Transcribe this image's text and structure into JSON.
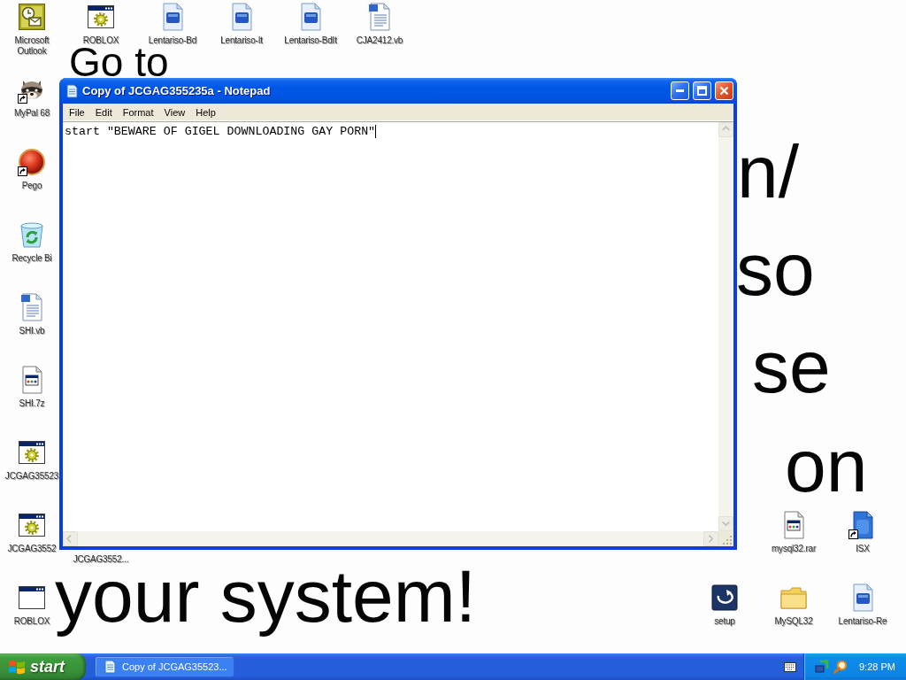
{
  "desktop": {
    "wallpaper_text": [
      "Go to",
      "n/",
      "so",
      "se",
      "on",
      "your system!"
    ],
    "icons": [
      {
        "label": "Microsoft Outlook",
        "kind": "outlook",
        "shortcut": false
      },
      {
        "label": "ROBLOX",
        "kind": "program-gear",
        "shortcut": false
      },
      {
        "label": "Lentariso-Bd",
        "kind": "font-file",
        "shortcut": false
      },
      {
        "label": "Lentariso-It",
        "kind": "font-file",
        "shortcut": false
      },
      {
        "label": "Lentariso-BdIt",
        "kind": "font-file",
        "shortcut": false
      },
      {
        "label": "CJA2412.vb",
        "kind": "vb-script",
        "shortcut": false
      },
      {
        "label": "MyPal 68",
        "kind": "raccoon",
        "shortcut": true
      },
      {
        "label": "Pego",
        "kind": "red-ball",
        "shortcut": true
      },
      {
        "label": "Recycle Bi",
        "kind": "recycle-bin",
        "shortcut": false
      },
      {
        "label": "SHI.vb",
        "kind": "vb-script",
        "shortcut": false
      },
      {
        "label": "SHI.7z",
        "kind": "document-window",
        "shortcut": false
      },
      {
        "label": "JCGAG35523",
        "kind": "program-gear",
        "shortcut": false
      },
      {
        "label": "JCGAG3552",
        "kind": "program-gear",
        "shortcut": false
      },
      {
        "label": "ROBLOX",
        "kind": "program-window",
        "shortcut": false
      },
      {
        "label": "JCGAG3552...",
        "kind": "covered"
      },
      {
        "label": "mysql32.rar",
        "kind": "document-window",
        "shortcut": false
      },
      {
        "label": "ISX",
        "kind": "js-file",
        "shortcut": true
      },
      {
        "label": "setup",
        "kind": "setup",
        "shortcut": false
      },
      {
        "label": "MySQL32",
        "kind": "folder",
        "shortcut": false
      },
      {
        "label": "Lentariso-Re",
        "kind": "font-file",
        "shortcut": false
      }
    ]
  },
  "window": {
    "title": "Copy of JCGAG355235a - Notepad",
    "menu": [
      "File",
      "Edit",
      "Format",
      "View",
      "Help"
    ],
    "content": "start \"BEWARE OF GIGEL DOWNLOADING GAY PORN\""
  },
  "taskbar": {
    "start": "start",
    "tasks": [
      {
        "label": "Copy of JCGAG35523..."
      }
    ],
    "clock": "9:28 PM"
  }
}
